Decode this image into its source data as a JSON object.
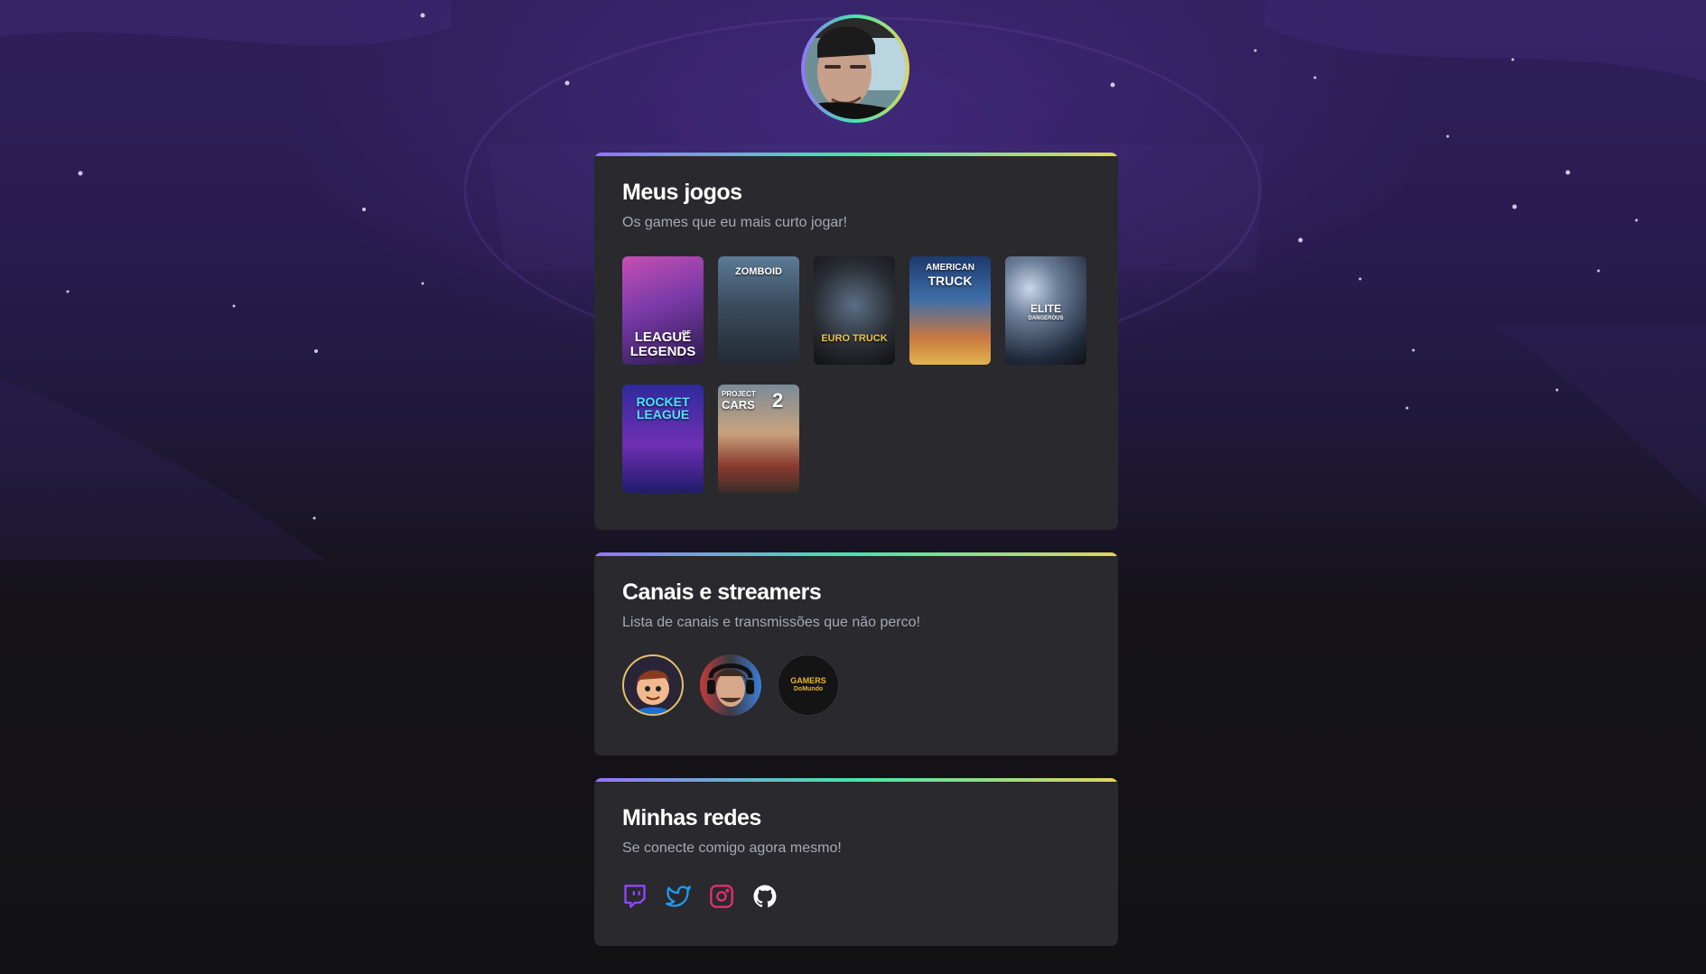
{
  "profile": {
    "avatar_alt": "Foto de perfil"
  },
  "games_section": {
    "title": "Meus jogos",
    "subtitle": "Os games que eu mais curto jogar!",
    "games": [
      {
        "name": "League of Legends",
        "cover_text_1": "LEAGUE",
        "cover_text_2": "LEGENDS",
        "cover_text_3": "OF"
      },
      {
        "name": "Project Zomboid",
        "cover_text_1": "ZOMBOID"
      },
      {
        "name": "Euro Truck Simulator 2",
        "cover_text_1": "EURO TRUCK"
      },
      {
        "name": "American Truck Simulator",
        "cover_text_1": "AMERICAN",
        "cover_text_2": "TRUCK"
      },
      {
        "name": "Elite Dangerous",
        "cover_text_1": "ELITE",
        "cover_text_2": "DANGEROUS"
      },
      {
        "name": "Rocket League",
        "cover_text_1": "ROCKET",
        "cover_text_2": "LEAGUE"
      },
      {
        "name": "Project CARS 2",
        "cover_text_1": "PROJECT",
        "cover_text_2": "CARS",
        "cover_text_3": "2"
      }
    ]
  },
  "streamers_section": {
    "title": "Canais e streamers",
    "subtitle": "Lista de canais e transmissões que não perco!",
    "logo_text_1": "GAMERS",
    "logo_text_2": "DoMundo"
  },
  "social_section": {
    "title": "Minhas redes",
    "subtitle": "Se conecte comigo agora mesmo!",
    "icons": [
      "twitch-icon",
      "twitter-icon",
      "instagram-icon",
      "github-icon"
    ]
  },
  "colors": {
    "card": "#29292e",
    "gradient": [
      "#9572fc",
      "#43e7ad",
      "#e2d45c"
    ],
    "twitch": "#9146ff",
    "twitter": "#1d9bf0",
    "instagram": "#e1306c",
    "github": "#ffffff"
  }
}
